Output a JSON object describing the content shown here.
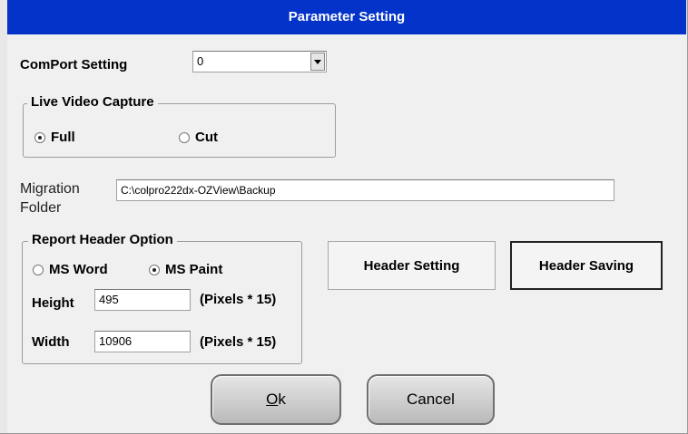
{
  "window": {
    "title": "Parameter Setting"
  },
  "comport": {
    "label": "ComPort Setting",
    "value": "0"
  },
  "live_video": {
    "legend": "Live Video Capture",
    "options": [
      {
        "label": "Full",
        "selected": true
      },
      {
        "label": "Cut",
        "selected": false
      }
    ]
  },
  "migration": {
    "label_line1": "Migration",
    "label_line2": "Folder",
    "value": "C:\\colpro222dx-OZView\\Backup"
  },
  "report_header": {
    "legend": "Report Header Option",
    "options": [
      {
        "label": "MS Word",
        "selected": false
      },
      {
        "label": "MS Paint",
        "selected": true
      }
    ],
    "height_label": "Height",
    "height_value": "495",
    "width_label": "Width",
    "width_value": "10906",
    "unit": "(Pixels * 15)"
  },
  "buttons": {
    "header_setting": "Header Setting",
    "header_saving": "Header Saving",
    "ok_accel": "O",
    "ok_rest": "k",
    "cancel": "Cancel"
  }
}
